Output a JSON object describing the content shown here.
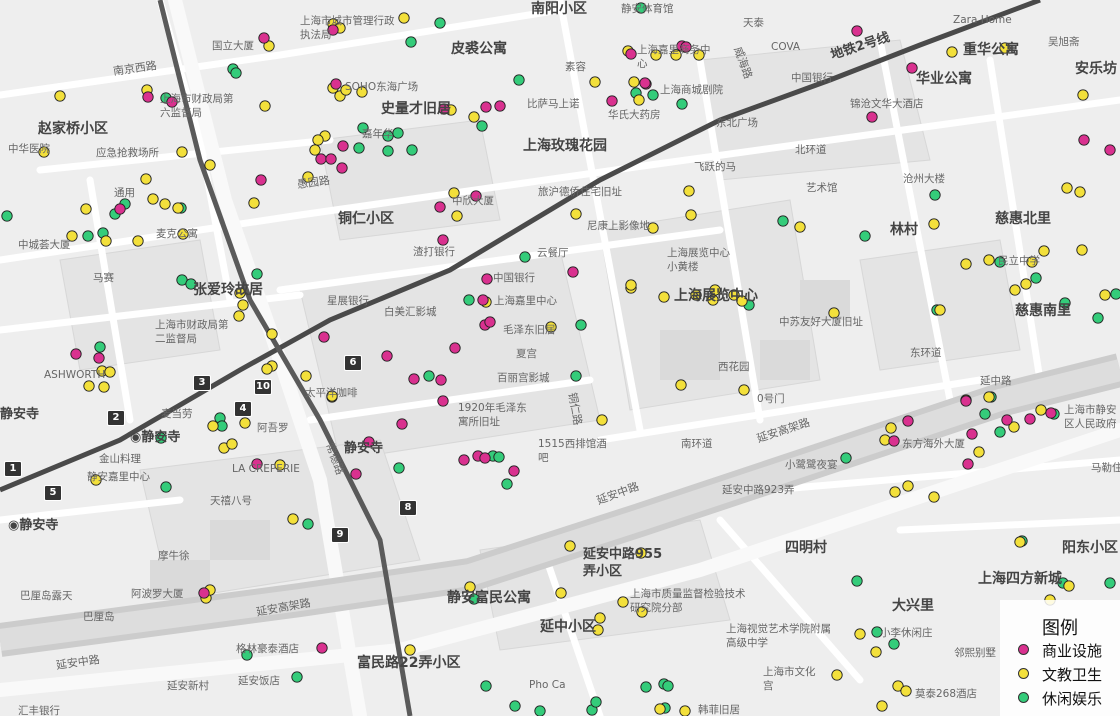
{
  "legend": {
    "title": "图例",
    "items": [
      {
        "label": "商业设施",
        "color": "#d9318f"
      },
      {
        "label": "文教卫生",
        "color": "#f3e03b"
      },
      {
        "label": "休闲娱乐",
        "color": "#34cc7a"
      }
    ]
  },
  "map": {
    "base_colors": {
      "background": "#eeeeee",
      "block": "#e2e2e2",
      "road": "#ffffff",
      "elevated": "#cfcfcf",
      "metro": "#555555"
    },
    "area_labels": [
      "南阳小区",
      "皮裘公寓",
      "华业公寓",
      "安乐坊",
      "赵家桥小区",
      "史量才旧居",
      "上海玫瑰花园",
      "铜仁小区",
      "张爱玲故居",
      "林村",
      "慈惠北里",
      "慈惠南里",
      "四明村",
      "阳东小区",
      "上海四方新城",
      "大兴里",
      "静安富民公寓",
      "延中小区",
      "富民路22弄小区",
      "延安中路955弄小区",
      "静安寺",
      "静安寺"
    ],
    "poi_labels": [
      "静安体育馆",
      "天泰",
      "Zara Home",
      "上海市城市管理行政执法局",
      "COVA",
      "重华公寓",
      "吴旭斋",
      "国立大厦",
      "上海嘉里商务中心",
      "北京西路",
      "中国银行",
      "上海市财政局第六监督局",
      "SOHO东海广场",
      "素容",
      "上海商城剧院",
      "锦沧文华大酒店",
      "中华医院",
      "应急抢救场所",
      "嘉年华",
      "比萨马上诺",
      "东北广场",
      "北环道",
      "华氏大药房",
      "飞跃的马",
      "沧州大楼",
      "麦克公寓",
      "中欣大厦",
      "旅沪德侨住宅旧址",
      "艺术馆",
      "通用",
      "新华亭",
      "尼康上影像地",
      "中城荟大厦",
      "渣打银行",
      "云餐厅",
      "上海展览中心小黄楼",
      "民立中学",
      "中国银行",
      "上海嘉里中心",
      "马赛",
      "星展银行",
      "白美汇影城",
      "上海展览中心",
      "上海市财政局第二监督局",
      "毛泽东旧居",
      "中苏友好大厦旧址",
      "ASHWORTH",
      "夏宫",
      "东环道",
      "西花园",
      "太平洋咖啡",
      "百丽宫影城",
      "0号门",
      "麦当劳",
      "1920年毛泽东寓所旧址",
      "延中路",
      "阿吾罗",
      "上海市静安区人民政府",
      "1515西排馆酒吧",
      "南环道",
      "东方海外大厦",
      "金山料理",
      "LA CREPERIE",
      "小鹭鹭夜宴",
      "马勒住宅",
      "静安嘉里中心",
      "延安中路923弄",
      "天禧八号",
      "摩牛徐",
      "巴厘岛露天",
      "阿波罗大厦",
      "上海市质量监督检验技术研究院分部",
      "巴厘岛",
      "上海视觉艺术学院附属高级中学",
      "小李休闲庄",
      "格林豪泰酒店",
      "上海市文化宫",
      "邻熙别墅",
      "延安新村",
      "延安饭店",
      "Pho Ca",
      "韩菲旧居",
      "莫泰268酒店",
      "汇丰银行"
    ],
    "road_labels": [
      "延安高架路",
      "延安中路",
      "延安东路",
      "地铁2号线",
      "南京西路",
      "愚园路",
      "常德路",
      "铜仁路",
      "威海路",
      "北京西路",
      "延安中路"
    ],
    "metro_exits": [
      "1",
      "2",
      "3",
      "4",
      "5",
      "6",
      "8",
      "9",
      "10"
    ],
    "metro_station": "静安寺"
  }
}
